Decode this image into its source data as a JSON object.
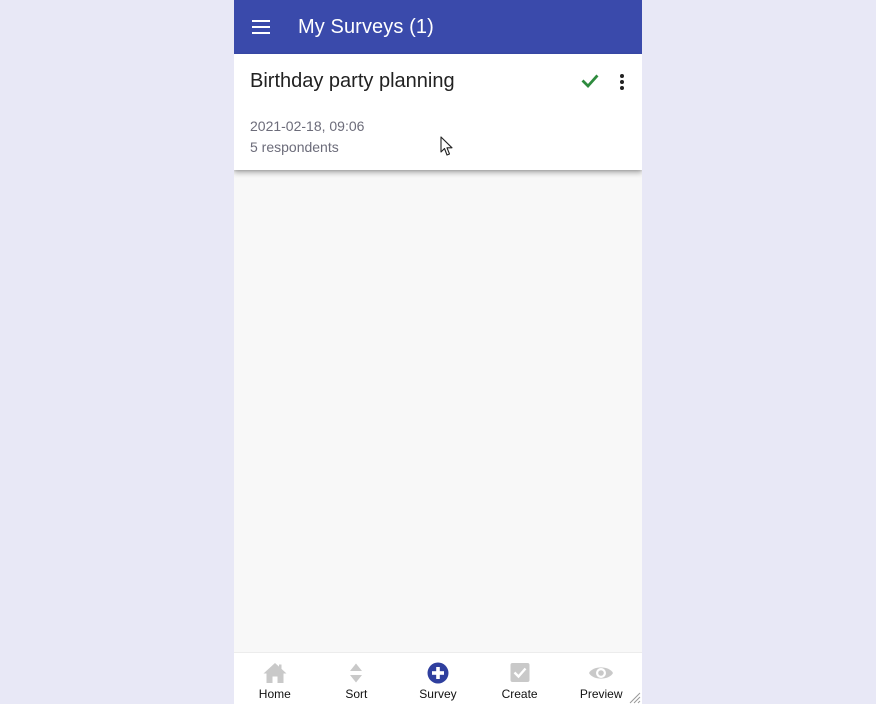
{
  "appbar": {
    "title": "My Surveys (1)",
    "menu_icon": "hamburger-menu-icon",
    "color": "#3a4aab"
  },
  "surveys": [
    {
      "title": "Birthday party planning",
      "date": "2021-02-18, 09:06",
      "respondents": "5 respondents",
      "status_icon": "check-icon",
      "status_color": "#2e8b3e"
    }
  ],
  "bottom_nav": {
    "items": [
      {
        "label": "Home",
        "icon": "home-icon",
        "active": false
      },
      {
        "label": "Sort",
        "icon": "sort-icon",
        "active": false
      },
      {
        "label": "Survey",
        "icon": "add-circle-icon",
        "active": true
      },
      {
        "label": "Create",
        "icon": "checkbox-icon",
        "active": false
      },
      {
        "label": "Preview",
        "icon": "eye-icon",
        "active": false
      }
    ],
    "active_color": "#2f3f9e",
    "inactive_color": "#c9c9c9"
  }
}
